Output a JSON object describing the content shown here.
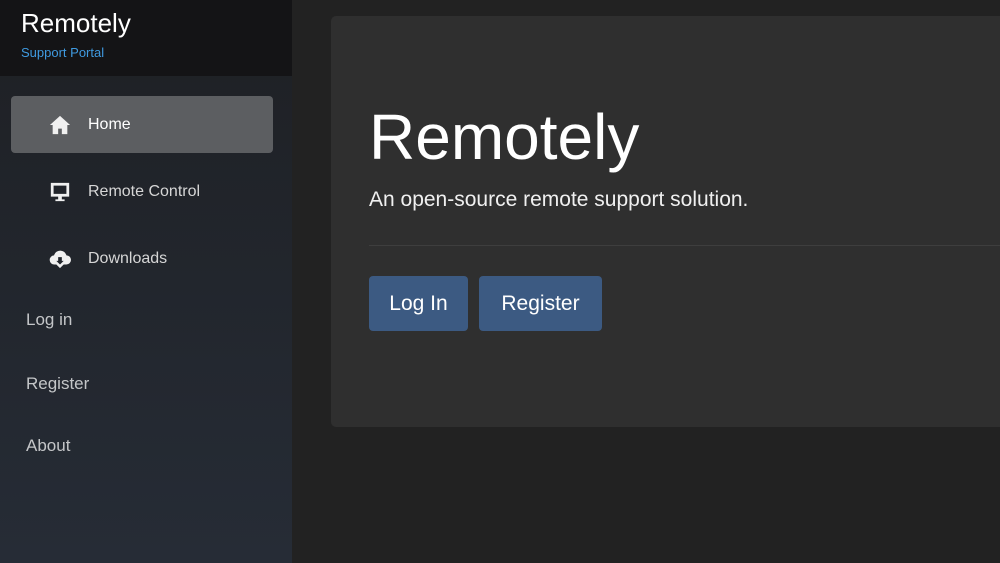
{
  "brand": {
    "title": "Remotely",
    "subtitle": "Support Portal"
  },
  "nav": [
    {
      "label": "Home",
      "icon": "home-icon"
    },
    {
      "label": "Remote Control",
      "icon": "monitor-icon"
    },
    {
      "label": "Downloads",
      "icon": "cloud-download-icon"
    }
  ],
  "links": [
    "Log in",
    "Register",
    "About"
  ],
  "main": {
    "title": "Remotely",
    "tagline": "An open-source remote support solution.",
    "login_label": "Log In",
    "register_label": "Register"
  },
  "colors": {
    "accent": "#3c5a82",
    "brand_sub": "#3f9ae0"
  }
}
